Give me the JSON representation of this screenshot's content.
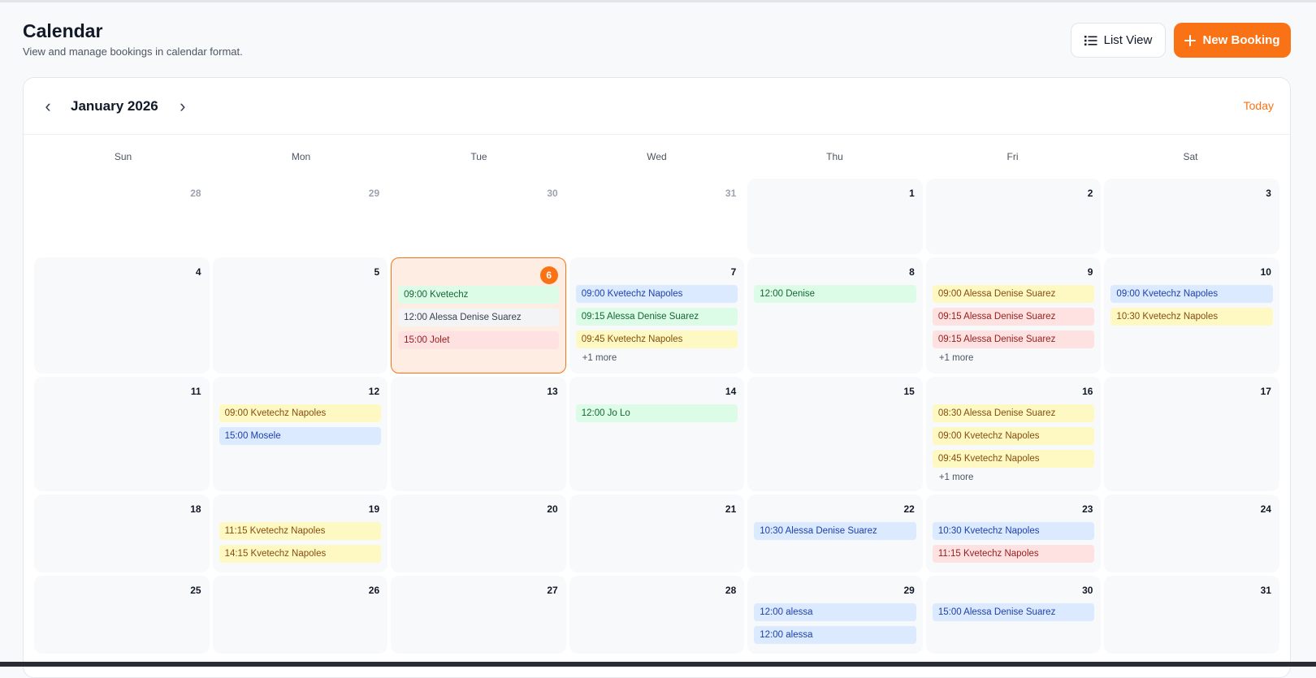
{
  "header": {
    "title": "Calendar",
    "subtitle": "View and manage bookings in calendar format.",
    "list_view": "List View",
    "new_booking": "New Booking"
  },
  "calendar": {
    "month": "January 2026",
    "today": "Today",
    "accent": "#f97316",
    "weekdays": [
      "Sun",
      "Mon",
      "Tue",
      "Wed",
      "Thu",
      "Fri",
      "Sat"
    ],
    "days": [
      {
        "n": "28",
        "out": true,
        "events": []
      },
      {
        "n": "29",
        "out": true,
        "events": []
      },
      {
        "n": "30",
        "out": true,
        "events": []
      },
      {
        "n": "31",
        "out": true,
        "events": []
      },
      {
        "n": "1",
        "events": []
      },
      {
        "n": "2",
        "events": []
      },
      {
        "n": "3",
        "events": []
      },
      {
        "n": "4",
        "events": []
      },
      {
        "n": "5",
        "events": []
      },
      {
        "n": "6",
        "today": true,
        "events": [
          {
            "t": "09:00 Kvetechz",
            "c": "green"
          },
          {
            "t": "12:00 Alessa Denise Suarez",
            "c": "gray"
          },
          {
            "t": "15:00 Jolet",
            "c": "red"
          }
        ]
      },
      {
        "n": "7",
        "events": [
          {
            "t": "09:00 Kvetechz Napoles",
            "c": "blue"
          },
          {
            "t": "09:15 Alessa Denise Suarez",
            "c": "green"
          },
          {
            "t": "09:45 Kvetechz Napoles",
            "c": "yellow"
          }
        ],
        "more": "+1 more"
      },
      {
        "n": "8",
        "events": [
          {
            "t": "12:00 Denise",
            "c": "green"
          }
        ]
      },
      {
        "n": "9",
        "events": [
          {
            "t": "09:00 Alessa Denise Suarez",
            "c": "yellow"
          },
          {
            "t": "09:15 Alessa Denise Suarez",
            "c": "red"
          },
          {
            "t": "09:15 Alessa Denise Suarez",
            "c": "red"
          }
        ],
        "more": "+1 more"
      },
      {
        "n": "10",
        "events": [
          {
            "t": "09:00 Kvetechz Napoles",
            "c": "blue"
          },
          {
            "t": "10:30 Kvetechz Napoles",
            "c": "yellow"
          }
        ]
      },
      {
        "n": "11",
        "events": []
      },
      {
        "n": "12",
        "events": [
          {
            "t": "09:00 Kvetechz Napoles",
            "c": "yellow"
          },
          {
            "t": "15:00 Mosele",
            "c": "blue"
          }
        ]
      },
      {
        "n": "13",
        "events": []
      },
      {
        "n": "14",
        "events": [
          {
            "t": "12:00 Jo Lo",
            "c": "green"
          }
        ]
      },
      {
        "n": "15",
        "events": []
      },
      {
        "n": "16",
        "events": [
          {
            "t": "08:30 Alessa Denise Suarez",
            "c": "yellow"
          },
          {
            "t": "09:00 Kvetechz Napoles",
            "c": "yellow"
          },
          {
            "t": "09:45 Kvetechz Napoles",
            "c": "yellow"
          }
        ],
        "more": "+1 more"
      },
      {
        "n": "17",
        "events": []
      },
      {
        "n": "18",
        "events": []
      },
      {
        "n": "19",
        "events": [
          {
            "t": "11:15 Kvetechz Napoles",
            "c": "yellow"
          },
          {
            "t": "14:15 Kvetechz Napoles",
            "c": "yellow"
          }
        ]
      },
      {
        "n": "20",
        "events": []
      },
      {
        "n": "21",
        "events": []
      },
      {
        "n": "22",
        "events": [
          {
            "t": "10:30 Alessa Denise Suarez",
            "c": "blue"
          }
        ]
      },
      {
        "n": "23",
        "events": [
          {
            "t": "10:30 Kvetechz Napoles",
            "c": "blue"
          },
          {
            "t": "11:15 Kvetechz Napoles",
            "c": "red"
          }
        ]
      },
      {
        "n": "24",
        "events": []
      },
      {
        "n": "25",
        "events": []
      },
      {
        "n": "26",
        "events": []
      },
      {
        "n": "27",
        "events": []
      },
      {
        "n": "28",
        "events": []
      },
      {
        "n": "29",
        "events": [
          {
            "t": "12:00 alessa",
            "c": "blue"
          },
          {
            "t": "12:00 alessa",
            "c": "blue"
          }
        ]
      },
      {
        "n": "30",
        "events": [
          {
            "t": "15:00 Alessa Denise Suarez",
            "c": "blue"
          }
        ]
      },
      {
        "n": "31",
        "events": []
      }
    ]
  }
}
